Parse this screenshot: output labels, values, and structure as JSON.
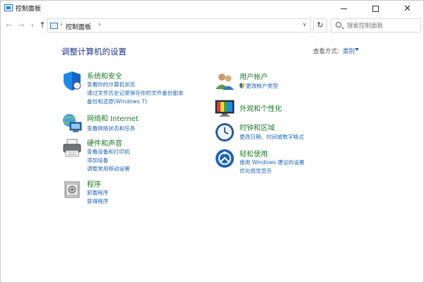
{
  "window": {
    "title": "控制面板"
  },
  "address": {
    "crumb": "控制面板"
  },
  "search": {
    "placeholder": "搜索控制面板"
  },
  "header": {
    "title": "调整计算机的设置",
    "view_by_label": "查看方式:",
    "view_by_value": "类别"
  },
  "categories": [
    {
      "title": "系统和安全",
      "icon": "shield-icon",
      "links": [
        "查看你的计算机状态",
        "通过文件历史记录保存你的文件备份副本",
        "备份和还原(Windows 7)"
      ]
    },
    {
      "title": "网络和 Internet",
      "icon": "network-icon",
      "links": [
        "查看网络状态和任务"
      ]
    },
    {
      "title": "硬件和声音",
      "icon": "printer-icon",
      "links": [
        "查看设备和打印机",
        "添加设备",
        "调整常用移动设置"
      ]
    },
    {
      "title": "程序",
      "icon": "programs-icon",
      "links": [
        "卸载程序",
        "获得程序"
      ]
    },
    {
      "title": "用户帐户",
      "icon": "users-icon",
      "links": [
        "更改帐户类型"
      ]
    },
    {
      "title": "外观和个性化",
      "icon": "appearance-icon",
      "links": []
    },
    {
      "title": "时钟和区域",
      "icon": "clock-icon",
      "links": [
        "更改日期、时间或数字格式"
      ]
    },
    {
      "title": "轻松使用",
      "icon": "accessibility-icon",
      "links": [
        "使用 Windows 建议的设置",
        "优化视觉显示"
      ]
    }
  ],
  "colors": {
    "title": "#1e3287",
    "category": "#1e7a2a",
    "link": "#1d63b8"
  }
}
